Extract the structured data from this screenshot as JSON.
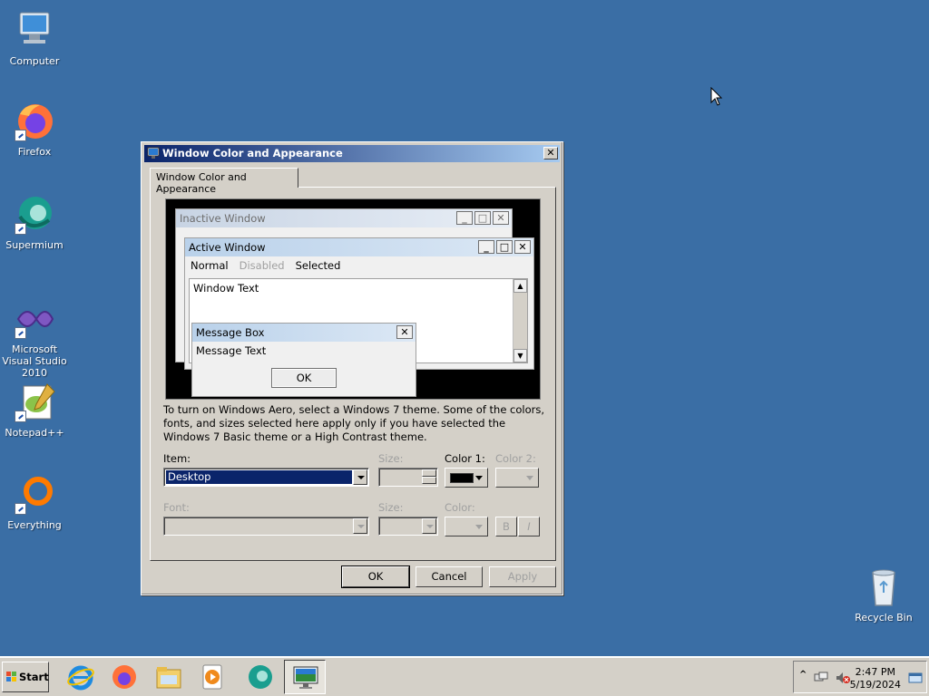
{
  "desktop": {
    "icons": [
      {
        "label": "Computer",
        "icon": "computer-icon"
      },
      {
        "label": "Firefox",
        "icon": "firefox-icon"
      },
      {
        "label": "Supermium",
        "icon": "supermium-icon"
      },
      {
        "label": "Microsoft Visual Studio 2010",
        "icon": "visual-studio-icon"
      },
      {
        "label": "Notepad++",
        "icon": "notepadpp-icon"
      },
      {
        "label": "Everything",
        "icon": "everything-icon"
      },
      {
        "label": "Recycle Bin",
        "icon": "recycle-bin-icon"
      }
    ],
    "background_color": "#3a6ea5"
  },
  "dialog": {
    "title": "Window Color and Appearance",
    "close_label": "✕",
    "tab_label": "Window Color and Appearance",
    "preview": {
      "inactive_title": "Inactive Window",
      "active_title": "Active Window",
      "menu_normal": "Normal",
      "menu_disabled": "Disabled",
      "menu_selected": "Selected",
      "window_text": "Window Text",
      "msgbox_title": "Message Box",
      "msgbox_text": "Message Text",
      "msgbox_ok": "OK",
      "minimize_glyph": "_",
      "maximize_glyph": "□",
      "close_glyph": "✕"
    },
    "info_text": "To turn on Windows Aero, select a Windows 7 theme.  Some of the colors, fonts, and sizes selected here apply only if you have selected the Windows 7 Basic theme or a High Contrast theme.",
    "item_label": "Item:",
    "item_value": "Desktop",
    "size_label": "Size:",
    "color1_label": "Color 1:",
    "color1_value": "#000000",
    "color2_label": "Color 2:",
    "font_label": "Font:",
    "font_size_label": "Size:",
    "font_color_label": "Color:",
    "bold_label": "B",
    "italic_label": "I",
    "ok_label": "OK",
    "cancel_label": "Cancel",
    "apply_label": "Apply"
  },
  "taskbar": {
    "start_label": "Start",
    "apps": [
      "internet-explorer-icon",
      "firefox-icon",
      "file-explorer-icon",
      "media-player-icon",
      "supermium-icon",
      "display-settings-icon"
    ],
    "tray_chevron": "^",
    "time": "2:47 PM",
    "date": "5/19/2024"
  }
}
